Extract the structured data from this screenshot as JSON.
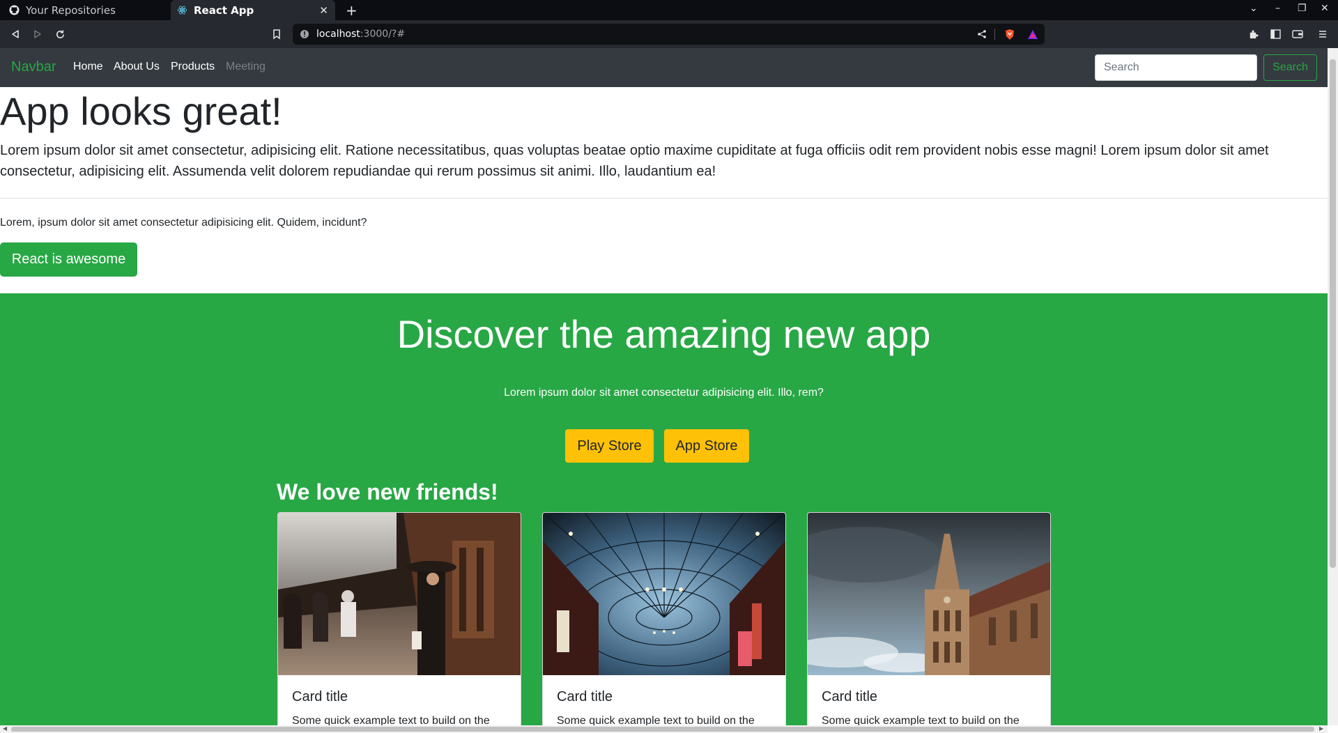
{
  "browser": {
    "tabs": [
      {
        "title": "Your Repositories",
        "icon": "github-icon"
      },
      {
        "title": "React App",
        "icon": "react-icon"
      }
    ],
    "url_host": "localhost",
    "url_rest": ":3000/?#"
  },
  "navbar": {
    "brand": "Navbar",
    "links": [
      "Home",
      "About Us",
      "Products",
      "Meeting"
    ],
    "search_placeholder": "Search",
    "search_button": "Search"
  },
  "hero": {
    "title": "App looks great!",
    "lead": "Lorem ipsum dolor sit amet consectetur, adipisicing elit. Ratione necessitatibus, quas voluptas beatae optio maxime cupiditate at fuga officiis odit rem provident nobis esse magni! Lorem ipsum dolor sit amet consectetur, adipisicing elit. Assumenda velit dolorem repudiandae qui rerum possimus sit animi. Illo, laudantium ea!",
    "small": "Lorem, ipsum dolor sit amet consectetur adipisicing elit. Quidem, incidunt?",
    "button": "React is awesome"
  },
  "promo": {
    "title": "Discover the amazing new app",
    "subtitle": "Lorem ipsum dolor sit amet consectetur adipisicing elit. Illo, rem?",
    "buttons": [
      "Play Store",
      "App Store"
    ],
    "friends_heading": "We love new friends!"
  },
  "cards": [
    {
      "title": "Card title",
      "text": "Some quick example text to build on the",
      "image": "street-photo"
    },
    {
      "title": "Card title",
      "text": "Some quick example text to build on the",
      "image": "arcade-photo"
    },
    {
      "title": "Card title",
      "text": "Some quick example text to build on the",
      "image": "cathedral-photo"
    }
  ],
  "colors": {
    "brand_green": "#28a745",
    "navbar_bg": "#343a40",
    "warning_yellow": "#ffc107"
  }
}
